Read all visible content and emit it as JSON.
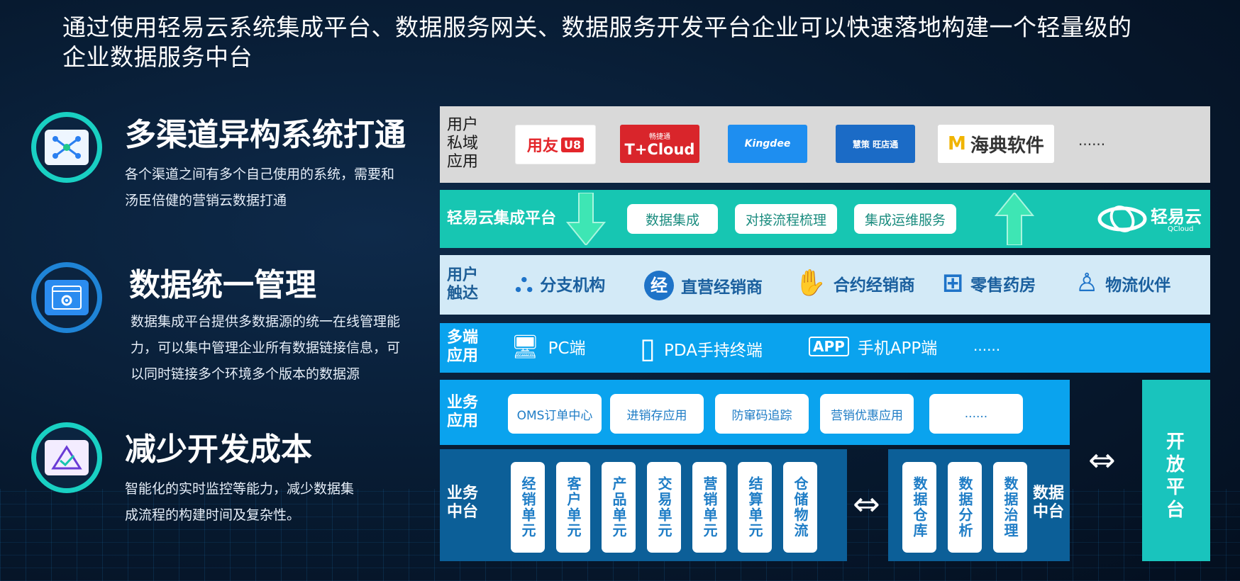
{
  "headline": "通过使用轻易云系统集成平台、数据服务网关、数据服务开发平台企业可以快速落地构建一个轻量级的企业数据服务中台",
  "features": [
    {
      "title": "多渠道异构系统打通",
      "desc_lines": [
        "各个渠道之间有多个自己使用的系统，需要和",
        "汤臣倍健的营销云数据打通"
      ],
      "icon": "network-icon"
    },
    {
      "title": "数据统一管理",
      "desc_lines": [
        "数据集成平台提供多数据源的统一在线管理能",
        "力，可以集中管理企业所有数据链接信息，可",
        "以同时链接多个环境多个版本的数据源"
      ],
      "icon": "settings-window-icon"
    },
    {
      "title": "减少开发成本",
      "desc_lines": [
        "智能化的实时监控等能力，减少数据集",
        "成流程的构建时间及复杂性。"
      ],
      "icon": "check-triangle-icon"
    }
  ],
  "diagram": {
    "private_domain": {
      "label": "用户私域应用",
      "logos": [
        "用友",
        "U8",
        "畅捷通",
        "T+Cloud",
        "Kingdee",
        "慧策 旺店通",
        "海典软件"
      ],
      "more": "......"
    },
    "integration": {
      "label": "轻易云集成平台",
      "pills": [
        "数据集成",
        "对接流程梳理",
        "集成运维服务"
      ],
      "brand": "轻易云",
      "brand_sub": "QCloud"
    },
    "reach": {
      "label": "用户触达",
      "items": [
        {
          "icon": "org-chart-icon",
          "text": "分支机构",
          "glyph": "⛬"
        },
        {
          "icon": "badge-icon",
          "text": "直营经销商",
          "glyph": "经"
        },
        {
          "icon": "handshake-icon",
          "text": "合约经销商",
          "glyph": "✋"
        },
        {
          "icon": "shop-icon",
          "text": "零售药房",
          "glyph": "⊞"
        },
        {
          "icon": "people-icon",
          "text": "物流伙伴",
          "glyph": "♙"
        }
      ]
    },
    "terminals": {
      "label": "多端应用",
      "items": [
        {
          "icon": "monitor-icon",
          "text": "PC端",
          "glyph": "🖥"
        },
        {
          "icon": "pda-icon",
          "text": "PDA手持终端",
          "glyph": "▯"
        },
        {
          "icon": "app-icon",
          "text": "手机APP端",
          "glyph": "APP"
        }
      ],
      "more": "......"
    },
    "biz_apps": {
      "label": "业务应用",
      "pills": [
        "OMS订单中心",
        "进销存应用",
        "防窜码追踪",
        "营销优惠应用",
        "......"
      ]
    },
    "biz_center": {
      "label": "业务中台",
      "units": [
        "经销单元",
        "客户单元",
        "产品单元",
        "交易单元",
        "营销单元",
        "结算单元",
        "仓储物流"
      ]
    },
    "data_center": {
      "label": "数据中台",
      "units": [
        "数据仓库",
        "数据分析",
        "数据治理"
      ]
    },
    "open_platform": {
      "label": "开放平台"
    },
    "colors": {
      "gray": "#d9d9d9",
      "teal": "#17c6b2",
      "light_blue": "#d3eaf7",
      "bright_blue": "#0aa3ee",
      "deep_blue": "#0c5f98",
      "cyan_panel": "#19c4bd"
    }
  }
}
